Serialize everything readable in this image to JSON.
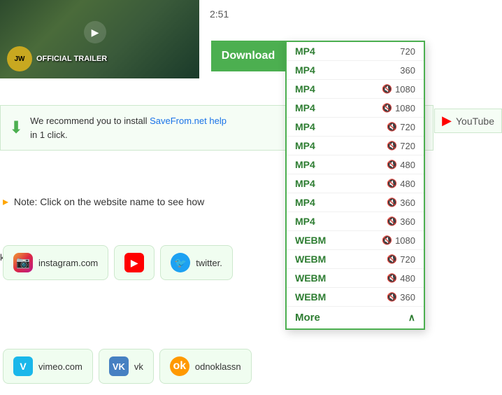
{
  "page": {
    "duration": "2:51",
    "download_button": "Download",
    "thumbnail": {
      "label": "OFFICIAL TRAILER",
      "logo_text": "JW"
    },
    "recommend": {
      "text_1": "We recommend you to install ",
      "link_text": "SaveFrom.net help",
      "text_2": "in 1 click.",
      "youtube_label": "YouTube"
    },
    "note": {
      "text": "Note: Click on the website name to see how"
    },
    "dropdown": {
      "items": [
        {
          "format": "MP4",
          "quality": "720",
          "muted": false
        },
        {
          "format": "MP4",
          "quality": "360",
          "muted": false
        },
        {
          "format": "MP4",
          "quality": "1080",
          "muted": true
        },
        {
          "format": "MP4",
          "quality": "1080",
          "muted": true
        },
        {
          "format": "MP4",
          "quality": "720",
          "muted": true
        },
        {
          "format": "MP4",
          "quality": "720",
          "muted": true
        },
        {
          "format": "MP4",
          "quality": "480",
          "muted": true
        },
        {
          "format": "MP4",
          "quality": "480",
          "muted": true
        },
        {
          "format": "MP4",
          "quality": "360",
          "muted": true
        },
        {
          "format": "MP4",
          "quality": "360",
          "muted": true
        },
        {
          "format": "WEBM",
          "quality": "1080",
          "muted": true
        },
        {
          "format": "WEBM",
          "quality": "720",
          "muted": true
        },
        {
          "format": "WEBM",
          "quality": "480",
          "muted": true
        },
        {
          "format": "WEBM",
          "quality": "360",
          "muted": true
        }
      ],
      "more_label": "More",
      "more_expanded": true
    },
    "websites_row1": [
      {
        "name": "instagram.com",
        "icon": "insta"
      },
      {
        "name": "youtube",
        "icon": "yt",
        "partial": true
      },
      {
        "name": "twitter.",
        "icon": "tw",
        "partial": true
      }
    ],
    "websites_row2": [
      {
        "name": "vimeo.com",
        "icon": "vimeo"
      },
      {
        "name": "vk",
        "icon": "vk",
        "partial": true
      },
      {
        "name": "odnoklassn",
        "icon": "ok",
        "partial": true
      }
    ],
    "clipped_left": "k.com",
    "colors": {
      "green": "#4caf50",
      "dark_green": "#2e7d32",
      "link_blue": "#1a73e8",
      "muted_red": "#e53935"
    }
  }
}
